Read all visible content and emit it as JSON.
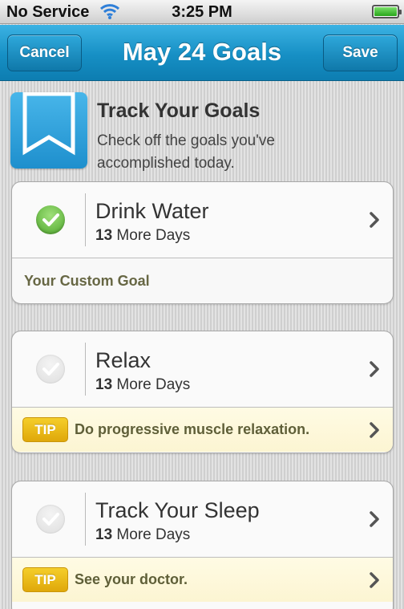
{
  "status_bar": {
    "carrier": "No Service",
    "time": "3:25 PM"
  },
  "nav": {
    "cancel_label": "Cancel",
    "title": "May 24 Goals",
    "save_label": "Save"
  },
  "header": {
    "title": "Track Your Goals",
    "subtitle": "Check off the goals you've accomplished today."
  },
  "goals": [
    {
      "name": "Drink Water",
      "days_count": "13",
      "days_label": "More Days",
      "checked": true,
      "footer_type": "custom",
      "footer_text": "Your Custom Goal"
    },
    {
      "name": "Relax",
      "days_count": "13",
      "days_label": "More Days",
      "checked": false,
      "footer_type": "tip",
      "tip_label": "TIP",
      "footer_text": "Do progressive muscle relaxation."
    },
    {
      "name": "Track Your Sleep",
      "days_count": "13",
      "days_label": "More Days",
      "checked": false,
      "footer_type": "tip",
      "tip_label": "TIP",
      "footer_text": "See your doctor."
    }
  ],
  "icons": {
    "wifi": "wifi-icon",
    "battery": "battery-icon",
    "goal": "bookmark-icon",
    "check": "checkmark-icon",
    "chevron": "chevron-right-icon"
  },
  "colors": {
    "nav_blue": "#168fc4",
    "check_green": "#4ea72c",
    "tip_yellow": "#dfa80a",
    "tip_bg": "#fcf5d2"
  }
}
